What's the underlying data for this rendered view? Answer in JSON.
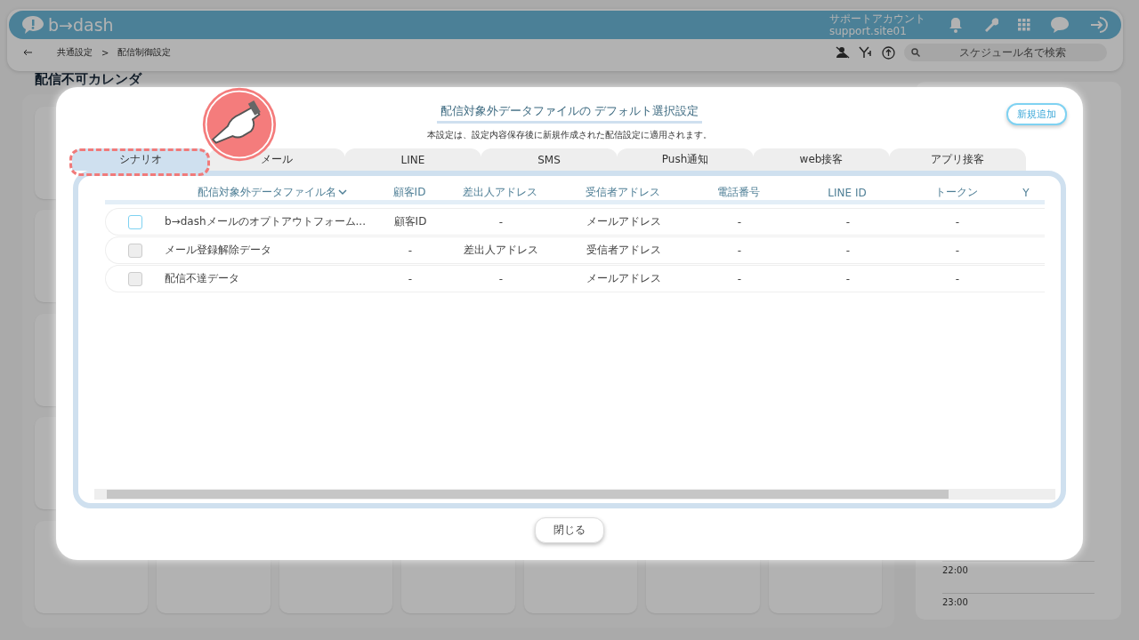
{
  "header": {
    "logo": "b→dash",
    "account_label": "サポートアカウント",
    "account_id": "support.site01"
  },
  "toolbar": {
    "breadcrumb": [
      "共通設定",
      "配信制御設定"
    ],
    "separator": ">",
    "search": {
      "placeholder": "スケジュール名で検索"
    }
  },
  "background": {
    "heading": "配信不可カレンダ",
    "times": [
      "22:00",
      "23:00"
    ]
  },
  "modal": {
    "title": "配信対象外データファイルの デフォルト選択設定",
    "subtitle": "本設定は、設定内容保存後に新規作成された配信設定に適用されます。",
    "add_button": "新規追加",
    "tabs": [
      {
        "label": "シナリオ",
        "selected": true
      },
      {
        "label": "メール",
        "selected": false
      },
      {
        "label": "LINE",
        "selected": false
      },
      {
        "label": "SMS",
        "selected": false
      },
      {
        "label": "Push通知",
        "selected": false
      },
      {
        "label": "web接客",
        "selected": false
      },
      {
        "label": "アプリ接客",
        "selected": false
      }
    ],
    "table": {
      "columns": [
        "配信対象外データファイル名",
        "顧客ID",
        "差出人アドレス",
        "受信者アドレス",
        "電話番号",
        "LINE ID",
        "トークン",
        "Y"
      ],
      "rows": [
        {
          "disabled": false,
          "cells": [
            "b→dashメールのオプトアウトフォーム...",
            "顧客ID",
            "-",
            "メールアドレス",
            "-",
            "-",
            "-"
          ]
        },
        {
          "disabled": true,
          "cells": [
            "メール登録解除データ",
            "-",
            "差出人アドレス",
            "受信者アドレス",
            "-",
            "-",
            "-"
          ]
        },
        {
          "disabled": true,
          "cells": [
            "配信不達データ",
            "-",
            "-",
            "メールアドレス",
            "-",
            "-",
            "-"
          ]
        }
      ]
    },
    "close_button": "閉じる"
  }
}
